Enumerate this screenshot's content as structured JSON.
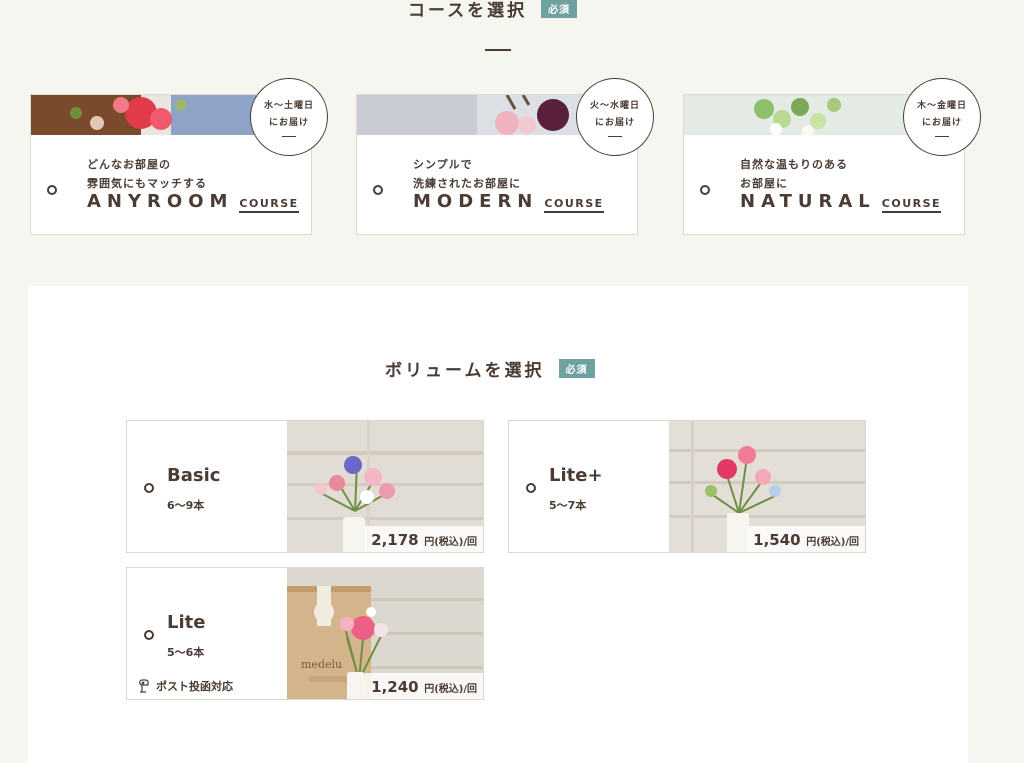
{
  "course_section": {
    "title": "コースを選択",
    "required_badge": "必須",
    "courses": [
      {
        "desc_line1": "どんなお部屋の",
        "desc_line2": "雰囲気にもマッチする",
        "name": "ANYROOM",
        "suffix": "COURSE",
        "delivery_line1": "水〜土曜日",
        "delivery_line2": "にお届け"
      },
      {
        "desc_line1": "シンプルで",
        "desc_line2": "洗練されたお部屋に",
        "name": "MODERN",
        "suffix": "COURSE",
        "delivery_line1": "火〜水曜日",
        "delivery_line2": "にお届け"
      },
      {
        "desc_line1": "自然な温もりのある",
        "desc_line2": "お部屋に",
        "name": "NATURAL",
        "suffix": "COURSE",
        "delivery_line1": "木〜金曜日",
        "delivery_line2": "にお届け"
      }
    ]
  },
  "volume_section": {
    "title": "ボリュームを選択",
    "required_badge": "必須",
    "options": [
      {
        "name": "Basic",
        "count": "6〜9本",
        "price": "2,178",
        "price_unit": "円(税込)/回"
      },
      {
        "name": "Lite+",
        "count": "5〜7本",
        "price": "1,540",
        "price_unit": "円(税込)/回"
      },
      {
        "name": "Lite",
        "count": "5〜6本",
        "price": "1,240",
        "price_unit": "円(税込)/回",
        "note": "ポスト投函対応"
      }
    ]
  },
  "colors": {
    "background": "#f6f6f0",
    "text": "#4a3c34",
    "badge": "#6fa1a0",
    "panel": "#ffffff"
  }
}
